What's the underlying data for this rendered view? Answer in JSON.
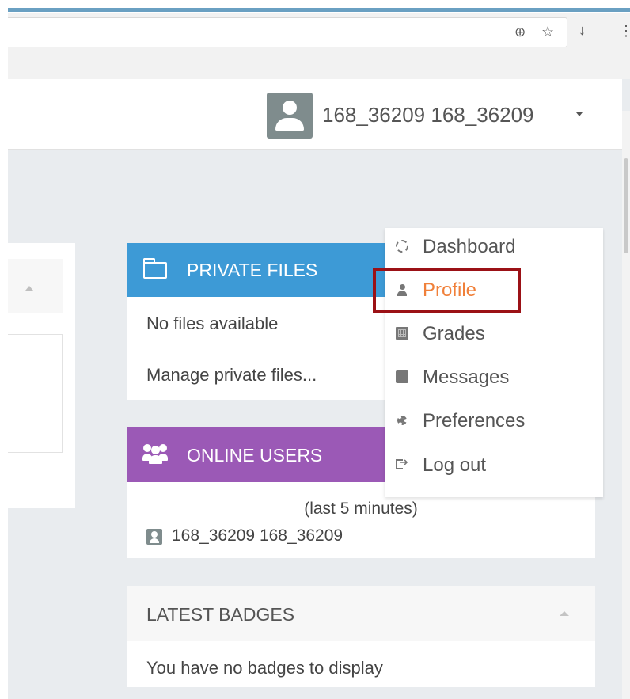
{
  "browser": {
    "zoom_icon": "zoom-icon",
    "star_icon": "star-icon",
    "download_icon": "download-icon",
    "more_icon": "more-icon"
  },
  "header": {
    "user_name": "168_36209 168_36209"
  },
  "user_menu": {
    "items": [
      {
        "label": "Dashboard",
        "icon": "dashboard-icon"
      },
      {
        "label": "Profile",
        "icon": "user-icon",
        "active": true
      },
      {
        "label": "Grades",
        "icon": "grades-icon"
      },
      {
        "label": "Messages",
        "icon": "messages-icon"
      },
      {
        "label": "Preferences",
        "icon": "preferences-icon"
      },
      {
        "label": "Log out",
        "icon": "logout-icon"
      }
    ]
  },
  "private_files": {
    "title": "PRIVATE FILES",
    "empty_text": "No files available",
    "manage_link": "Manage private files..."
  },
  "online_users": {
    "title": "ONLINE USERS",
    "subtitle": "(last 5 minutes)",
    "users": [
      "168_36209 168_36209"
    ]
  },
  "latest_badges": {
    "title": "LATEST BADGES",
    "empty_text": "You have no badges to display"
  },
  "colors": {
    "private_files_header": "#3d9ad6",
    "online_users_header": "#9b59b6",
    "active_menu_text": "#f0803a",
    "highlight_box": "#9b1116"
  }
}
